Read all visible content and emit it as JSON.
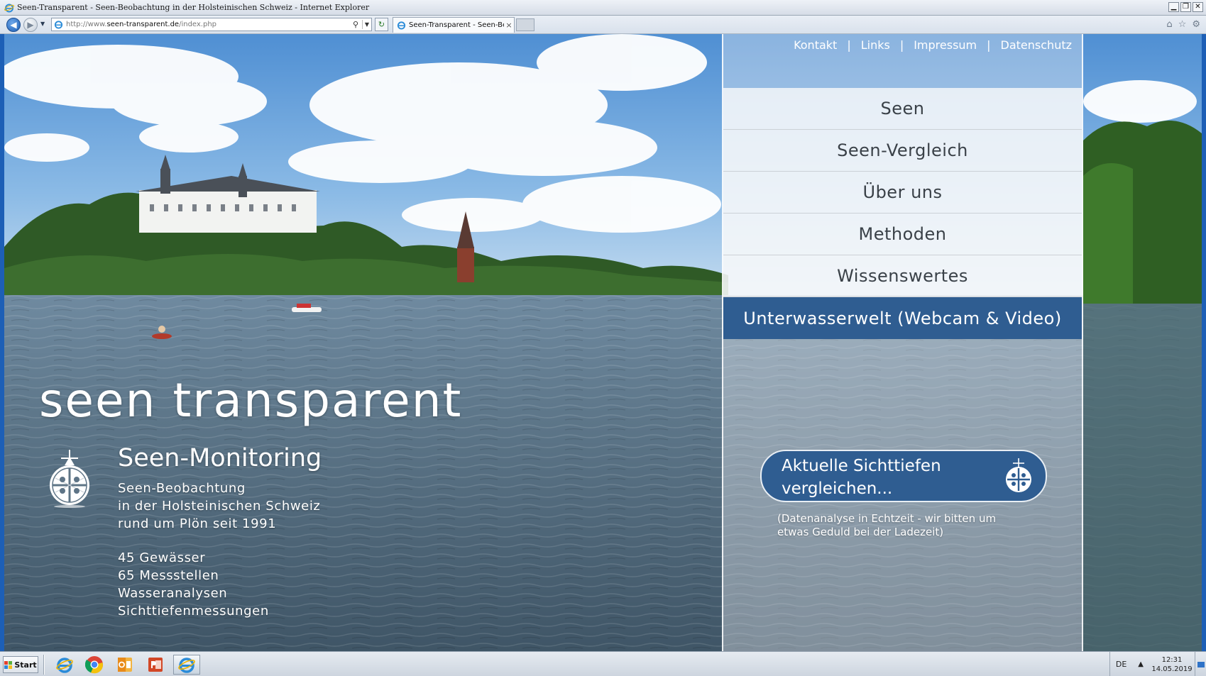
{
  "window": {
    "title": "Seen-Transparent - Seen-Beobachtung in der Holsteinischen Schweiz - Internet Explorer",
    "controls": [
      "▁",
      "❐",
      "✕"
    ]
  },
  "browser": {
    "url_prefix": "http://www.",
    "url_host": "seen-transparent.de",
    "url_path": "/index.php",
    "tab_label": "Seen-Transparent - Seen-Be...",
    "tab_close": "×"
  },
  "site": {
    "top_links": [
      "Kontakt",
      "Links",
      "Impressum",
      "Datenschutz"
    ],
    "link_separator": "|",
    "menu": [
      {
        "label": "Seen",
        "active": false
      },
      {
        "label": "Seen-Vergleich",
        "active": false
      },
      {
        "label": "Über uns",
        "active": false
      },
      {
        "label": "Methoden",
        "active": false
      },
      {
        "label": "Wissenswertes",
        "active": false
      },
      {
        "label": "Unterwasserwelt (Webcam & Video)",
        "active": true
      }
    ],
    "brand": "seen transparent",
    "monitoring_title": "Seen-Monitoring",
    "monitoring_lines": [
      "Seen-Beobachtung",
      "in der Holsteinischen Schweiz",
      "rund um Plön seit 1991"
    ],
    "stats": [
      "45 Gewässer",
      "65 Messstellen",
      "Wasseranalysen",
      "Sichttiefenmessungen"
    ],
    "cta_line1": "Aktuelle Sichttiefen",
    "cta_line2": "vergleichen...",
    "cta_note_line1": "(Datenanalyse in Echtzeit - wir bitten um",
    "cta_note_line2": "etwas Geduld bei der Ladezeit)"
  },
  "taskbar": {
    "start_label": "Start",
    "apps": [
      "internet-explorer",
      "chrome",
      "outlook",
      "powerpoint",
      "internet-explorer-active"
    ],
    "lang": "DE",
    "tray_up": "▲",
    "time": "12:31",
    "date": "14.05.2019"
  },
  "colors": {
    "accent_blue": "#2f5d91",
    "frame_blue": "#1d5fb6"
  }
}
